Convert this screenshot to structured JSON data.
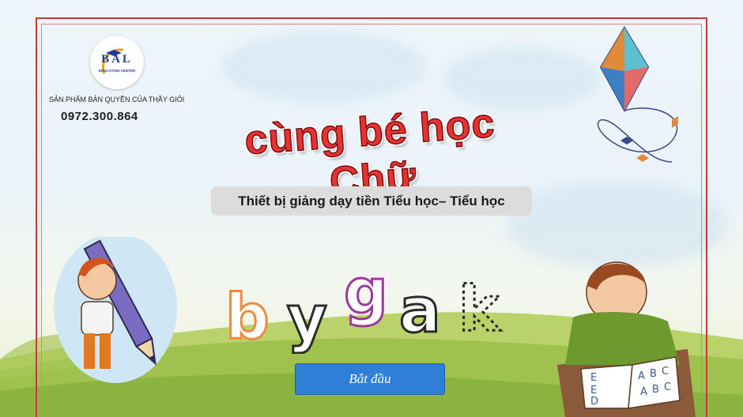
{
  "logo": {
    "brand": "BAL",
    "subtitle": "EDUCATION CENTER"
  },
  "header": {
    "copyright": "SẢN PHẨM BẢN QUYỀN CỦA THẦY GIỎI",
    "phone": "0972.300.864"
  },
  "title": "cùng bé học Chữ",
  "subtitle": "Thiết bị giảng dạy tiền Tiểu học– Tiểu học",
  "letters": [
    "b",
    "y",
    "g",
    "a",
    "k"
  ],
  "start_button": "Bắt đầu",
  "book_letters": [
    "E",
    "E",
    "D",
    "A",
    "B",
    "C",
    "A",
    "B",
    "C"
  ],
  "colors": {
    "title": "#e53333",
    "button": "#2f7fd6",
    "frame": "#c63a3a"
  }
}
